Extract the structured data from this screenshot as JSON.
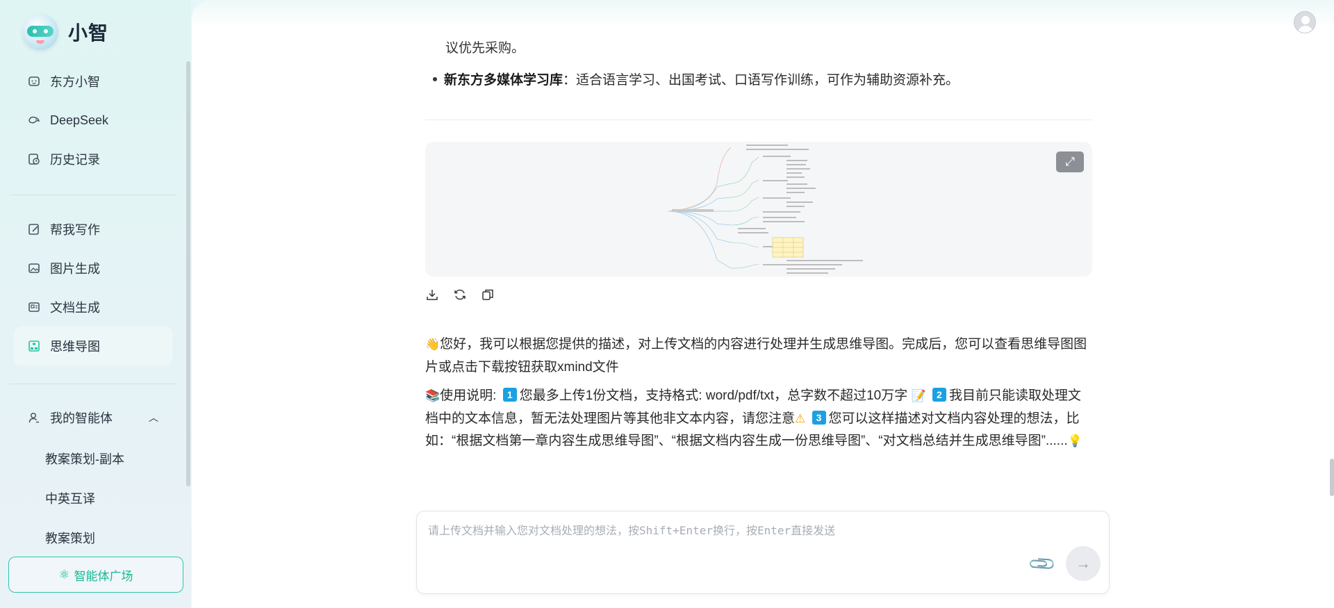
{
  "brand": {
    "name": "小智"
  },
  "nav_top": [
    {
      "label": "东方小智",
      "icon": "robot-face-icon"
    },
    {
      "label": "DeepSeek",
      "icon": "whale-icon"
    },
    {
      "label": "历史记录",
      "icon": "history-icon"
    }
  ],
  "nav_tools": [
    {
      "label": "帮我写作",
      "icon": "write-icon"
    },
    {
      "label": "图片生成",
      "icon": "image-icon"
    },
    {
      "label": "文档生成",
      "icon": "document-icon"
    },
    {
      "label": "思维导图",
      "icon": "mindmap-icon",
      "active": true
    }
  ],
  "agents": {
    "label": "我的智能体",
    "items": [
      "教案策划-副本",
      "中英互译",
      "教案策划"
    ]
  },
  "plaza_button": "智能体广场",
  "chat": {
    "cut_line": "议优先采购。",
    "bullet_bold": "新东方多媒体学习库",
    "bullet_text": "：适合语言学习、出国考试、口语写作训练，可作为辅助资源补充。",
    "intro": "您好，我可以根据您提供的描述，对上传文档的内容进行处理并生成思维导图。完成后，您可以查看思维导图图片或点击下载按钮获取xmind文件",
    "usage_prefix": "使用说明:",
    "usage_1": "您最多上传1份文档，支持格式: word/pdf/txt，总字数不超过10万字",
    "usage_2": "我目前只能读取处理文档中的文本信息，暂无法处理图片等其他非文本内容，请您注意",
    "usage_3": "您可以这样描述对文档内容处理的想法，比如：“根据文档第一章内容生成思维导图”、“根据文档内容生成一份思维导图”、“对文档总结并生成思维导图”......",
    "num_1": "1",
    "num_2": "2",
    "num_3": "3"
  },
  "input": {
    "placeholder": "请上传文档并输入您对文档处理的想法，按Shift+Enter换行，按Enter直接发送"
  },
  "colors": {
    "accent": "#20c4a0",
    "badge": "#1ba1e2"
  }
}
